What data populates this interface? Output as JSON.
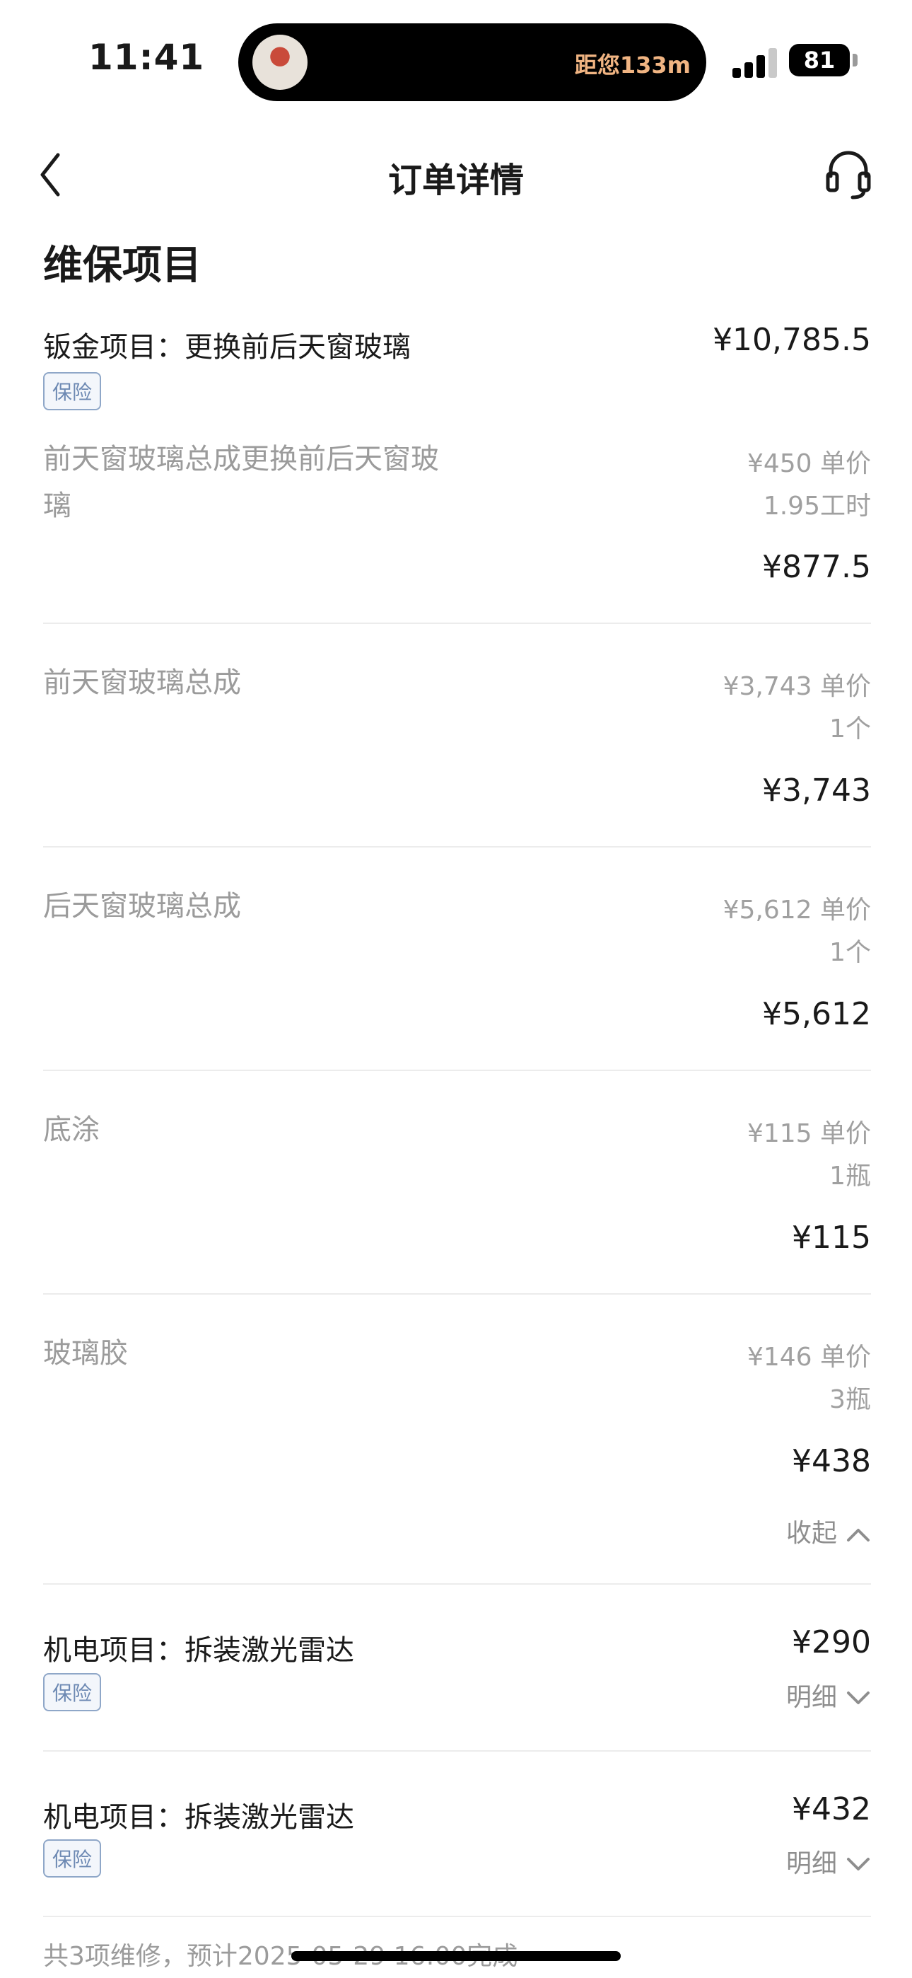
{
  "status_bar": {
    "time": "11:41",
    "island_text": "距您133m",
    "battery": "81"
  },
  "nav": {
    "title": "订单详情",
    "back_icon": "chevron-left-icon",
    "service_icon": "headset-icon"
  },
  "section_title": "维保项目",
  "items": [
    {
      "label": "钣金项目：更换前后天窗玻璃",
      "price": "¥10,785.5",
      "badge": "保险",
      "toggle": "收起",
      "parts": [
        {
          "name": "前天窗玻璃总成更换前后天窗玻璃",
          "unit_price": "¥450 单价",
          "qty": "1.95工时",
          "total": "¥877.5"
        },
        {
          "name": "前天窗玻璃总成",
          "unit_price": "¥3,743 单价",
          "qty": "1个",
          "total": "¥3,743"
        },
        {
          "name": "后天窗玻璃总成",
          "unit_price": "¥5,612 单价",
          "qty": "1个",
          "total": "¥5,612"
        },
        {
          "name": "底涂",
          "unit_price": "¥115 单价",
          "qty": "1瓶",
          "total": "¥115"
        },
        {
          "name": "玻璃胶",
          "unit_price": "¥146 单价",
          "qty": "3瓶",
          "total": "¥438"
        }
      ]
    },
    {
      "label": "机电项目：拆装激光雷达",
      "price": "¥290",
      "badge": "保险",
      "toggle": "明细"
    },
    {
      "label": "机电项目：拆装激光雷达",
      "price": "¥432",
      "badge": "保险",
      "toggle": "明细"
    }
  ],
  "footer_note": "共3项维修，预计2025-05-29 16:00完成"
}
